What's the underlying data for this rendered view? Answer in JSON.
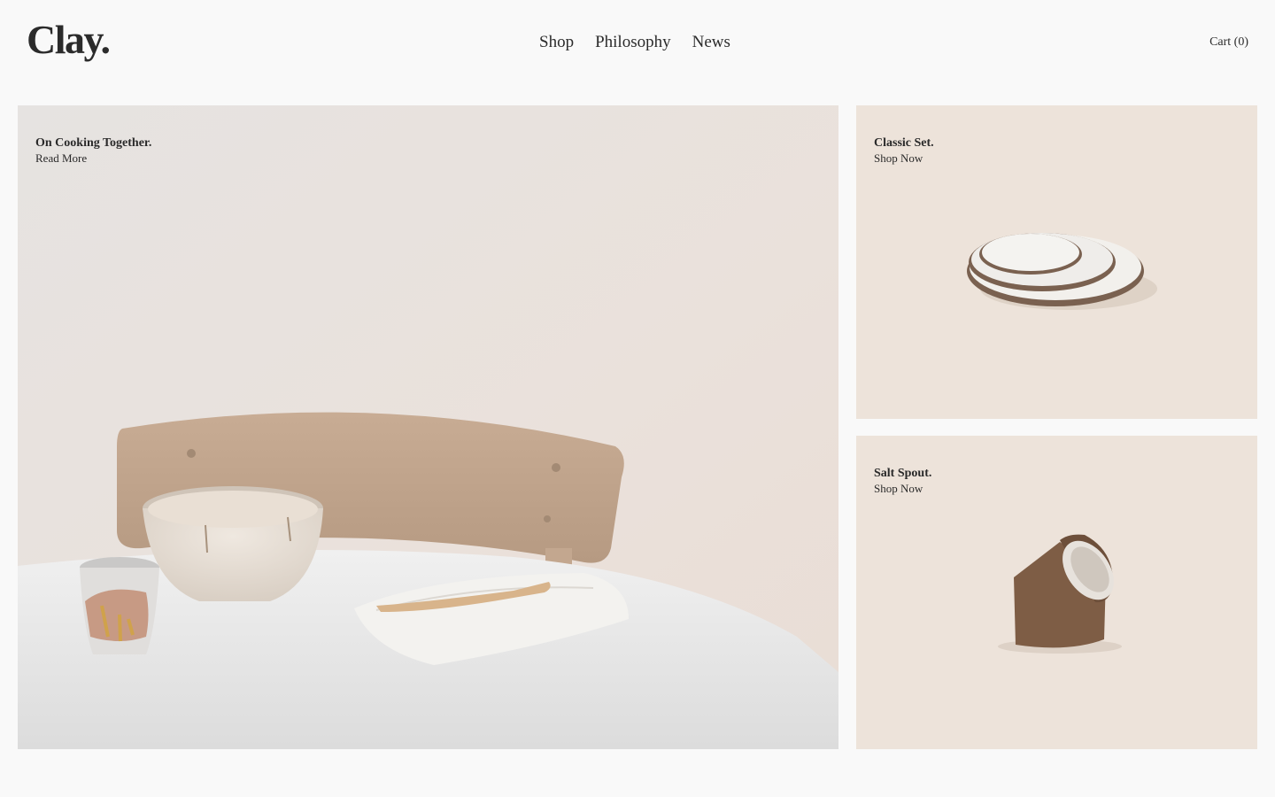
{
  "brand": {
    "logo": "Clay."
  },
  "nav": {
    "items": [
      {
        "label": "Shop"
      },
      {
        "label": "Philosophy"
      },
      {
        "label": "News"
      }
    ]
  },
  "cart": {
    "label": "Cart (0)"
  },
  "hero": {
    "title": "On Cooking Together.",
    "link": "Read More"
  },
  "products": [
    {
      "title": "Classic Set.",
      "link": "Shop Now"
    },
    {
      "title": "Salt Spout.",
      "link": "Shop Now"
    }
  ],
  "colors": {
    "background": "#f9f9f9",
    "card_background": "#ede3da",
    "text": "#2a2a2a"
  }
}
